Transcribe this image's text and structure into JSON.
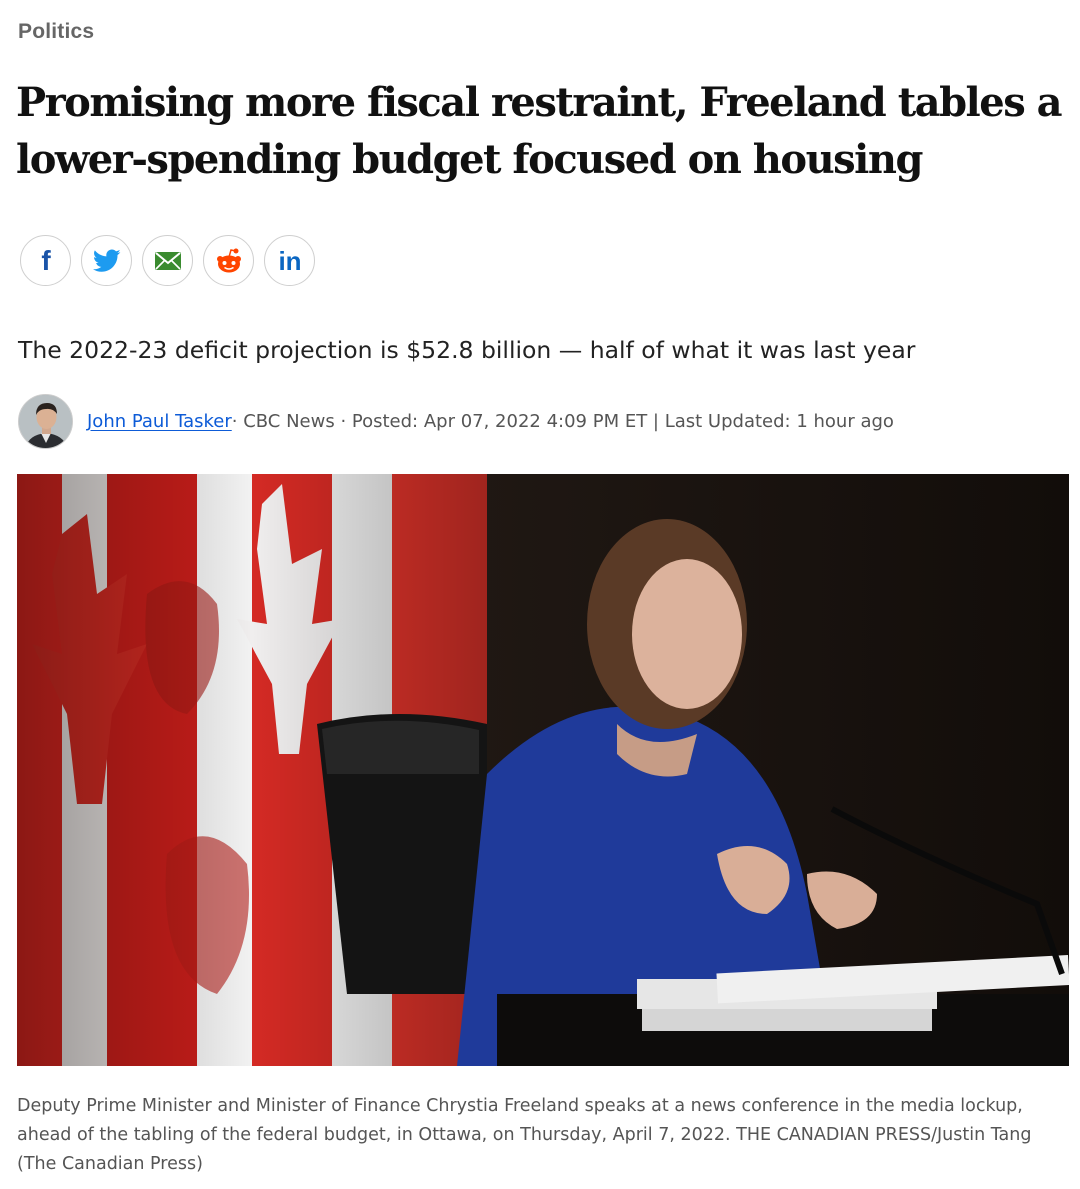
{
  "section": {
    "label": "Politics"
  },
  "article": {
    "headline": "Promising more fiscal restraint, Freeland tables a lower-spending budget focused on housing",
    "deck": "The 2022-23 deficit projection is $52.8 billion — half of what it was last year"
  },
  "share": [
    {
      "icon": "facebook-icon",
      "label": "f",
      "color": "#1a54a8"
    },
    {
      "icon": "twitter-icon",
      "color": "#1d9bf0"
    },
    {
      "icon": "email-icon",
      "color": "#3a8b2f"
    },
    {
      "icon": "reddit-icon",
      "color": "#ff4500"
    },
    {
      "icon": "linkedin-icon",
      "label": "in",
      "color": "#0a66c2"
    }
  ],
  "byline": {
    "author": "John Paul Tasker",
    "source": " · CBC News · Posted: Apr 07, 2022 4:09 PM ET | Last Updated: 1 hour ago"
  },
  "photo": {
    "caption": "Deputy Prime Minister and Minister of Finance Chrystia Freeland speaks at a news conference in the media lockup, ahead of the tabling of the federal budget, in Ottawa, on Thursday, April 7, 2022. THE CANADIAN PRESS/Justin Tang (The Canadian Press)"
  }
}
